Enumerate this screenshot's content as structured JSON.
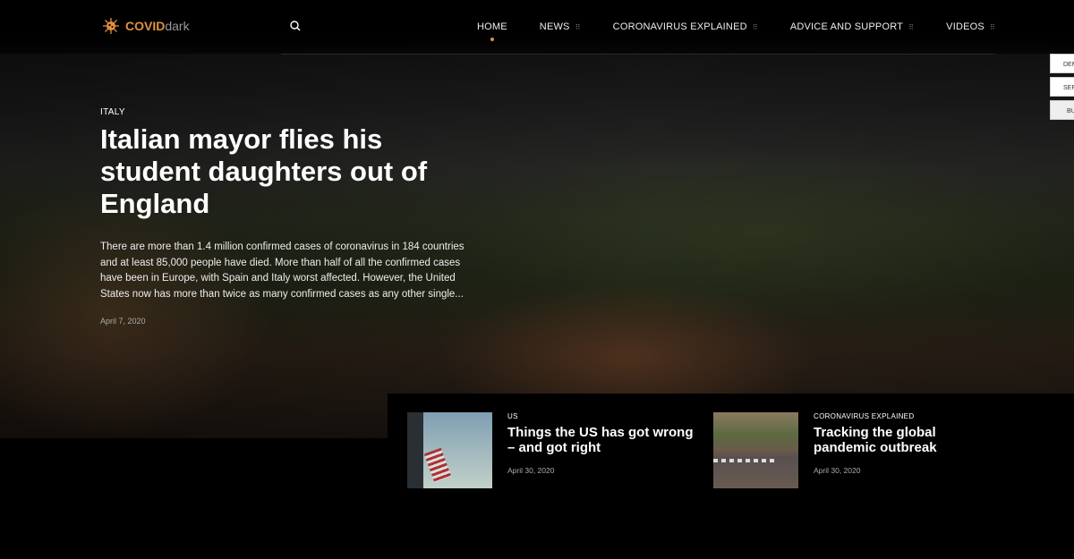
{
  "brand": {
    "name_accent": "COVID",
    "name_rest": "dark",
    "accent_color": "#e0913e"
  },
  "nav": {
    "items": [
      {
        "label": "HOME",
        "active": true
      },
      {
        "label": "NEWS",
        "menu": true
      },
      {
        "label": "CORONAVIRUS EXPLAINED",
        "menu": true
      },
      {
        "label": "ADVICE AND SUPPORT",
        "menu": true
      },
      {
        "label": "VIDEOS",
        "menu": true
      }
    ]
  },
  "side_buttons": [
    "DEM",
    "SERV",
    "BU"
  ],
  "hero": {
    "category": "ITALY",
    "title": "Italian mayor flies his student daughters out of England",
    "excerpt": "There are more than 1.4 million confirmed cases of coronavirus in 184 countries and at least 85,000 people have died. More than half of all the confirmed cases have been in Europe, with Spain and Italy worst affected. However, the United States now has more than twice as many confirmed cases as any other single...",
    "date": "April 7, 2020"
  },
  "cards": [
    {
      "category": "US",
      "title": "Things the US has got wrong – and got right",
      "date": "April 30, 2020"
    },
    {
      "category": "CORONAVIRUS EXPLAINED",
      "title": "Tracking the global pandemic outbreak",
      "date": "April 30, 2020"
    }
  ]
}
